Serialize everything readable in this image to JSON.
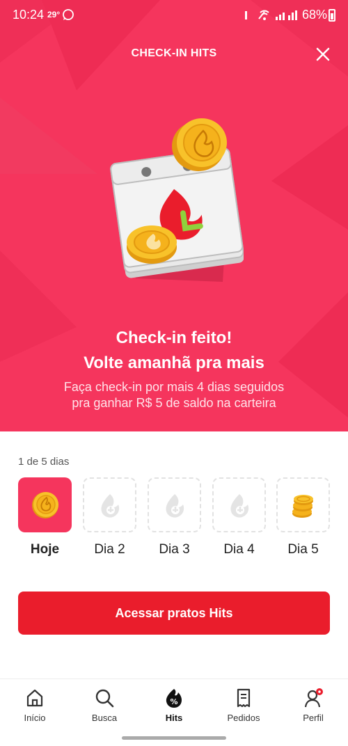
{
  "status_bar": {
    "time": "10:24",
    "temperature": "29°",
    "battery": "68%"
  },
  "header": {
    "title": "CHECK-IN HITS"
  },
  "hero": {
    "headline_line1": "Check-in feito!",
    "headline_line2": "Volte amanhã pra mais",
    "subtext": "Faça check-in por mais 4 dias seguidos pra ganhar R$ 5 de saldo na carteira"
  },
  "progress": {
    "label": "1 de 5 dias",
    "days": [
      {
        "label": "Hoje",
        "state": "done",
        "icon": "flame-coin-icon"
      },
      {
        "label": "Dia 2",
        "state": "pending",
        "icon": "flame-icon"
      },
      {
        "label": "Dia 3",
        "state": "pending",
        "icon": "flame-icon"
      },
      {
        "label": "Dia 4",
        "state": "pending",
        "icon": "flame-icon"
      },
      {
        "label": "Dia 5",
        "state": "reward",
        "icon": "coin-stack-icon"
      }
    ]
  },
  "cta": {
    "label": "Acessar pratos Hits"
  },
  "nav": {
    "items": [
      {
        "label": "Início",
        "icon": "home-icon"
      },
      {
        "label": "Busca",
        "icon": "search-icon"
      },
      {
        "label": "Hits",
        "icon": "hits-percent-icon",
        "active": true
      },
      {
        "label": "Pedidos",
        "icon": "receipt-icon"
      },
      {
        "label": "Perfil",
        "icon": "user-icon",
        "badge": true
      }
    ]
  },
  "colors": {
    "brand": "#ea1d2c",
    "hero_bg": "#f5355d",
    "coin": "#f5b21c"
  }
}
